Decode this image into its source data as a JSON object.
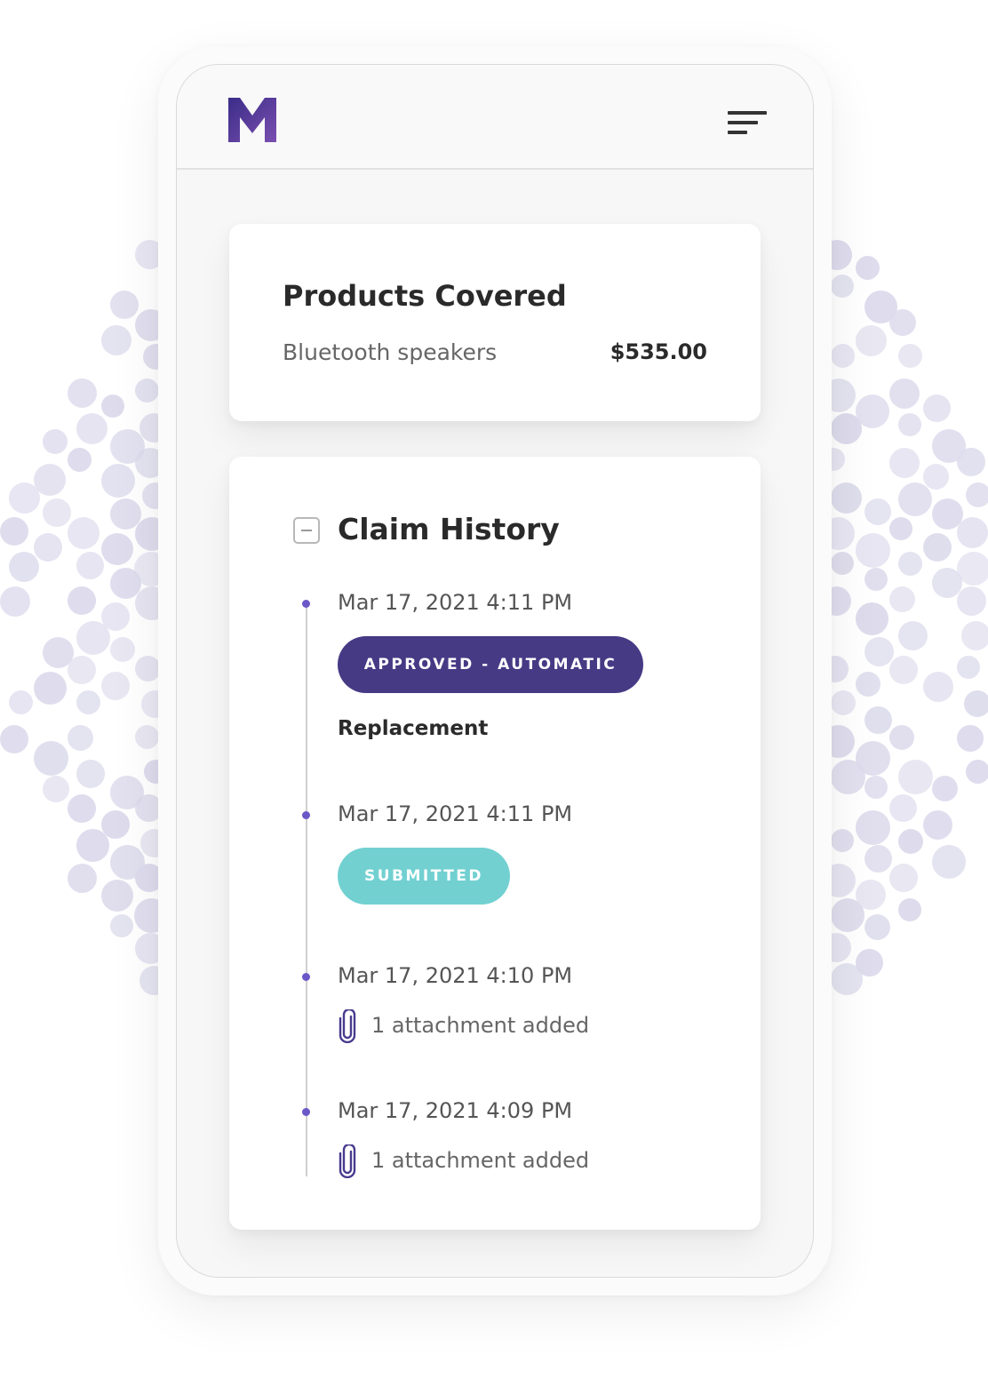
{
  "header": {
    "logo_letter": "M",
    "menu_icon": "hamburger-menu-icon"
  },
  "products": {
    "title": "Products Covered",
    "items": [
      {
        "name": "Bluetooth speakers",
        "price": "$535.00"
      }
    ]
  },
  "claim_history": {
    "title": "Claim History",
    "toggle_icon": "collapse-minus-icon",
    "events": [
      {
        "date": "Mar 17, 2021 4:11 PM",
        "badge": "APPROVED - AUTOMATIC",
        "detail": "Replacement"
      },
      {
        "date": "Mar 17, 2021 4:11 PM",
        "badge": "SUBMITTED"
      },
      {
        "date": "Mar 17, 2021 4:10 PM",
        "attachment": "1 attachment added"
      },
      {
        "date": "Mar 17, 2021 4:09 PM",
        "attachment": "1 attachment added"
      }
    ]
  },
  "colors": {
    "approved_badge": "#463a85",
    "submitted_badge": "#72d0d1",
    "timeline_dot": "#6b57c7",
    "brand_purple": "#3d2f8a"
  }
}
